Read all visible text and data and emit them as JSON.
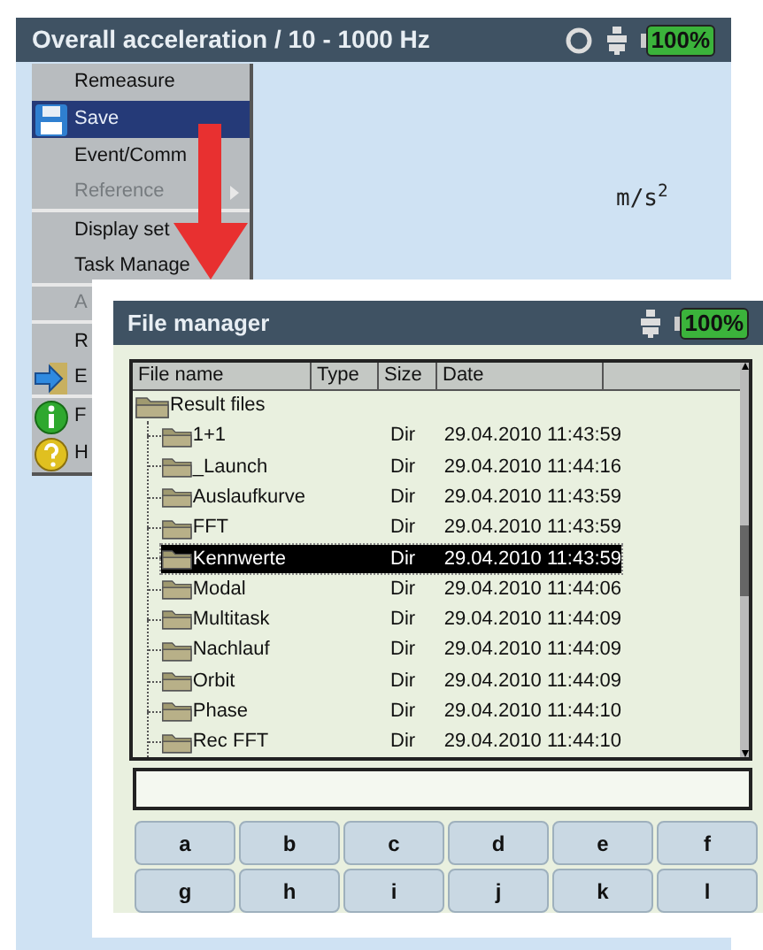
{
  "screen": {
    "title": "Overall acceleration / 10 - 1000 Hz",
    "battery": "100%",
    "unit": "m/s$^{2}$"
  },
  "menu": [
    {
      "label": "Remeasure",
      "kind": "plain",
      "selected": false,
      "disabled": false,
      "separator_after": false
    },
    {
      "label": "Save",
      "kind": "save",
      "selected": true,
      "disabled": false,
      "separator_after": false
    },
    {
      "label": "Event/Comm",
      "kind": "plain",
      "selected": false,
      "disabled": false,
      "separator_after": false
    },
    {
      "label": "Reference",
      "kind": "submenu",
      "selected": false,
      "disabled": true,
      "separator_after": true
    },
    {
      "label": "Display set",
      "kind": "plain",
      "selected": false,
      "disabled": false,
      "separator_after": false
    },
    {
      "label": "Task Manage",
      "kind": "plain",
      "selected": false,
      "disabled": false,
      "separator_after": true
    },
    {
      "label": "A",
      "kind": "plain",
      "selected": false,
      "disabled": true,
      "separator_after": true
    },
    {
      "label": "R",
      "kind": "plain",
      "selected": false,
      "disabled": false,
      "separator_after": false
    },
    {
      "label": "E",
      "kind": "exit",
      "selected": false,
      "disabled": false,
      "separator_after": true
    },
    {
      "label": "F",
      "kind": "info",
      "selected": false,
      "disabled": false,
      "separator_after": false
    },
    {
      "label": "H",
      "kind": "help",
      "selected": false,
      "disabled": false,
      "separator_after": false
    }
  ],
  "file_manager": {
    "title": "File manager",
    "battery": "100%",
    "columns": [
      "File name",
      "Type",
      "Size",
      "Date"
    ],
    "root": {
      "name": "Result files",
      "children": [
        {
          "name": "1+1",
          "size": "Dir",
          "date": "29.04.2010 11:43:59",
          "selected": false
        },
        {
          "name": "_Launch",
          "size": "Dir",
          "date": "29.04.2010 11:44:16",
          "selected": false
        },
        {
          "name": "Auslaufkurve",
          "size": "Dir",
          "date": "29.04.2010 11:43:59",
          "selected": false
        },
        {
          "name": "FFT",
          "size": "Dir",
          "date": "29.04.2010 11:43:59",
          "selected": false
        },
        {
          "name": "Kennwerte",
          "size": "Dir",
          "date": "29.04.2010 11:43:59",
          "selected": true
        },
        {
          "name": "Modal",
          "size": "Dir",
          "date": "29.04.2010 11:44:06",
          "selected": false
        },
        {
          "name": "Multitask",
          "size": "Dir",
          "date": "29.04.2010 11:44:09",
          "selected": false
        },
        {
          "name": "Nachlauf",
          "size": "Dir",
          "date": "29.04.2010 11:44:09",
          "selected": false
        },
        {
          "name": "Orbit",
          "size": "Dir",
          "date": "29.04.2010 11:44:09",
          "selected": false
        },
        {
          "name": "Phase",
          "size": "Dir",
          "date": "29.04.2010 11:44:10",
          "selected": false
        },
        {
          "name": "Rec FFT",
          "size": "Dir",
          "date": "29.04.2010 11:44:10",
          "selected": false
        }
      ]
    },
    "keys": [
      "a",
      "b",
      "c",
      "d",
      "e",
      "f",
      "g",
      "h",
      "i",
      "j",
      "k",
      "l"
    ]
  }
}
